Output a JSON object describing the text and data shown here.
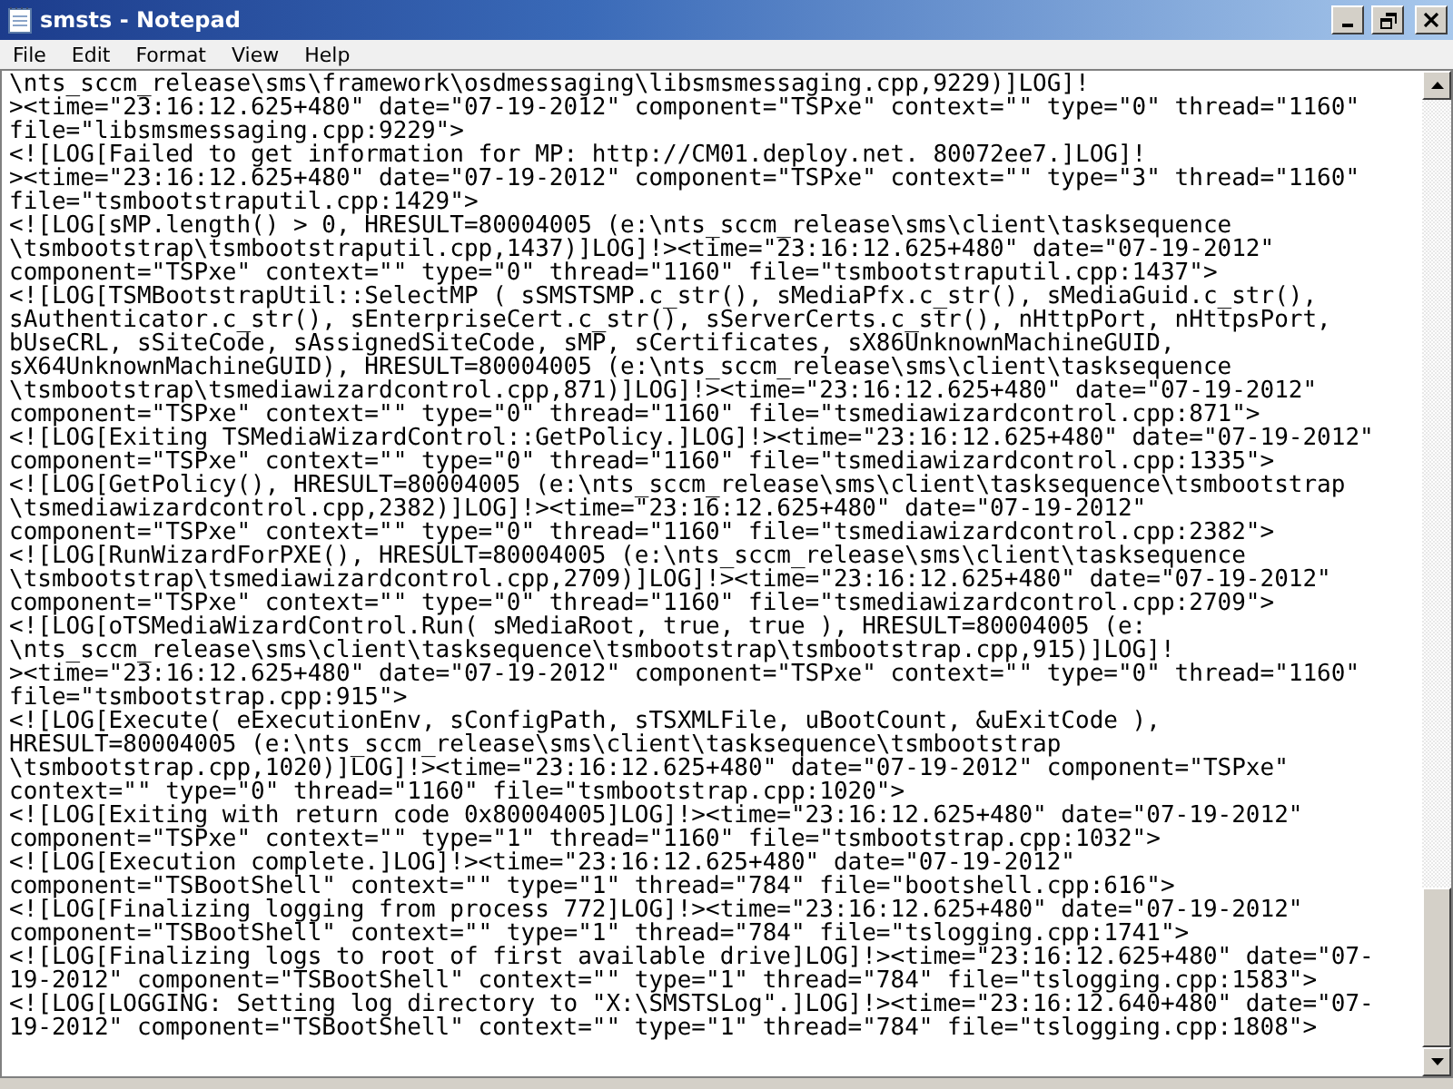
{
  "window": {
    "title": "smsts - Notepad"
  },
  "menu": [
    "File",
    "Edit",
    "Format",
    "View",
    "Help"
  ],
  "document": {
    "lines": [
      "\\nts_sccm_release\\sms\\framework\\osdmessaging\\libsmsmessaging.cpp,9229)]LOG]!",
      "><time=\"23:16:12.625+480\" date=\"07-19-2012\" component=\"TSPxe\" context=\"\" type=\"0\" thread=\"1160\"",
      "file=\"libsmsmessaging.cpp:9229\">",
      "<![LOG[Failed to get information for MP: http://CM01.deploy.net. 80072ee7.]LOG]!",
      "><time=\"23:16:12.625+480\" date=\"07-19-2012\" component=\"TSPxe\" context=\"\" type=\"3\" thread=\"1160\"",
      "file=\"tsmbootstraputil.cpp:1429\">",
      "<![LOG[sMP.length() > 0, HRESULT=80004005 (e:\\nts_sccm_release\\sms\\client\\tasksequence",
      "\\tsmbootstrap\\tsmbootstraputil.cpp,1437)]LOG]!><time=\"23:16:12.625+480\" date=\"07-19-2012\"",
      "component=\"TSPxe\" context=\"\" type=\"0\" thread=\"1160\" file=\"tsmbootstraputil.cpp:1437\">",
      "<![LOG[TSMBootstrapUtil::SelectMP ( sSMSTSMP.c_str(), sMediaPfx.c_str(), sMediaGuid.c_str(),",
      "sAuthenticator.c_str(), sEnterpriseCert.c_str(), sServerCerts.c_str(), nHttpPort, nHttpsPort,",
      "bUseCRL, sSiteCode, sAssignedSiteCode, sMP, sCertificates, sX86UnknownMachineGUID,",
      "sX64UnknownMachineGUID), HRESULT=80004005 (e:\\nts_sccm_release\\sms\\client\\tasksequence",
      "\\tsmbootstrap\\tsmediawizardcontrol.cpp,871)]LOG]!><time=\"23:16:12.625+480\" date=\"07-19-2012\"",
      "component=\"TSPxe\" context=\"\" type=\"0\" thread=\"1160\" file=\"tsmediawizardcontrol.cpp:871\">",
      "<![LOG[Exiting TSMediaWizardControl::GetPolicy.]LOG]!><time=\"23:16:12.625+480\" date=\"07-19-2012\"",
      "component=\"TSPxe\" context=\"\" type=\"0\" thread=\"1160\" file=\"tsmediawizardcontrol.cpp:1335\">",
      "<![LOG[GetPolicy(), HRESULT=80004005 (e:\\nts_sccm_release\\sms\\client\\tasksequence\\tsmbootstrap",
      "\\tsmediawizardcontrol.cpp,2382)]LOG]!><time=\"23:16:12.625+480\" date=\"07-19-2012\"",
      "component=\"TSPxe\" context=\"\" type=\"0\" thread=\"1160\" file=\"tsmediawizardcontrol.cpp:2382\">",
      "<![LOG[RunWizardForPXE(), HRESULT=80004005 (e:\\nts_sccm_release\\sms\\client\\tasksequence",
      "\\tsmbootstrap\\tsmediawizardcontrol.cpp,2709)]LOG]!><time=\"23:16:12.625+480\" date=\"07-19-2012\"",
      "component=\"TSPxe\" context=\"\" type=\"0\" thread=\"1160\" file=\"tsmediawizardcontrol.cpp:2709\">",
      "<![LOG[oTSMediaWizardControl.Run( sMediaRoot, true, true ), HRESULT=80004005 (e:",
      "\\nts_sccm_release\\sms\\client\\tasksequence\\tsmbootstrap\\tsmbootstrap.cpp,915)]LOG]!",
      "><time=\"23:16:12.625+480\" date=\"07-19-2012\" component=\"TSPxe\" context=\"\" type=\"0\" thread=\"1160\"",
      "file=\"tsmbootstrap.cpp:915\">",
      "<![LOG[Execute( eExecutionEnv, sConfigPath, sTSXMLFile, uBootCount, &uExitCode ),",
      "HRESULT=80004005 (e:\\nts_sccm_release\\sms\\client\\tasksequence\\tsmbootstrap",
      "\\tsmbootstrap.cpp,1020)]LOG]!><time=\"23:16:12.625+480\" date=\"07-19-2012\" component=\"TSPxe\"",
      "context=\"\" type=\"0\" thread=\"1160\" file=\"tsmbootstrap.cpp:1020\">",
      "<![LOG[Exiting with return code 0x80004005]LOG]!><time=\"23:16:12.625+480\" date=\"07-19-2012\"",
      "component=\"TSPxe\" context=\"\" type=\"1\" thread=\"1160\" file=\"tsmbootstrap.cpp:1032\">",
      "<![LOG[Execution complete.]LOG]!><time=\"23:16:12.625+480\" date=\"07-19-2012\"",
      "component=\"TSBootShell\" context=\"\" type=\"1\" thread=\"784\" file=\"bootshell.cpp:616\">",
      "<![LOG[Finalizing logging from process 772]LOG]!><time=\"23:16:12.625+480\" date=\"07-19-2012\"",
      "component=\"TSBootShell\" context=\"\" type=\"1\" thread=\"784\" file=\"tslogging.cpp:1741\">",
      "<![LOG[Finalizing logs to root of first available drive]LOG]!><time=\"23:16:12.625+480\" date=\"07-",
      "19-2012\" component=\"TSBootShell\" context=\"\" type=\"1\" thread=\"784\" file=\"tslogging.cpp:1583\">",
      "<![LOG[LOGGING: Setting log directory to \"X:\\SMSTSLog\".]LOG]!><time=\"23:16:12.640+480\" date=\"07-",
      "19-2012\" component=\"TSBootShell\" context=\"\" type=\"1\" thread=\"784\" file=\"tslogging.cpp:1808\">"
    ]
  }
}
